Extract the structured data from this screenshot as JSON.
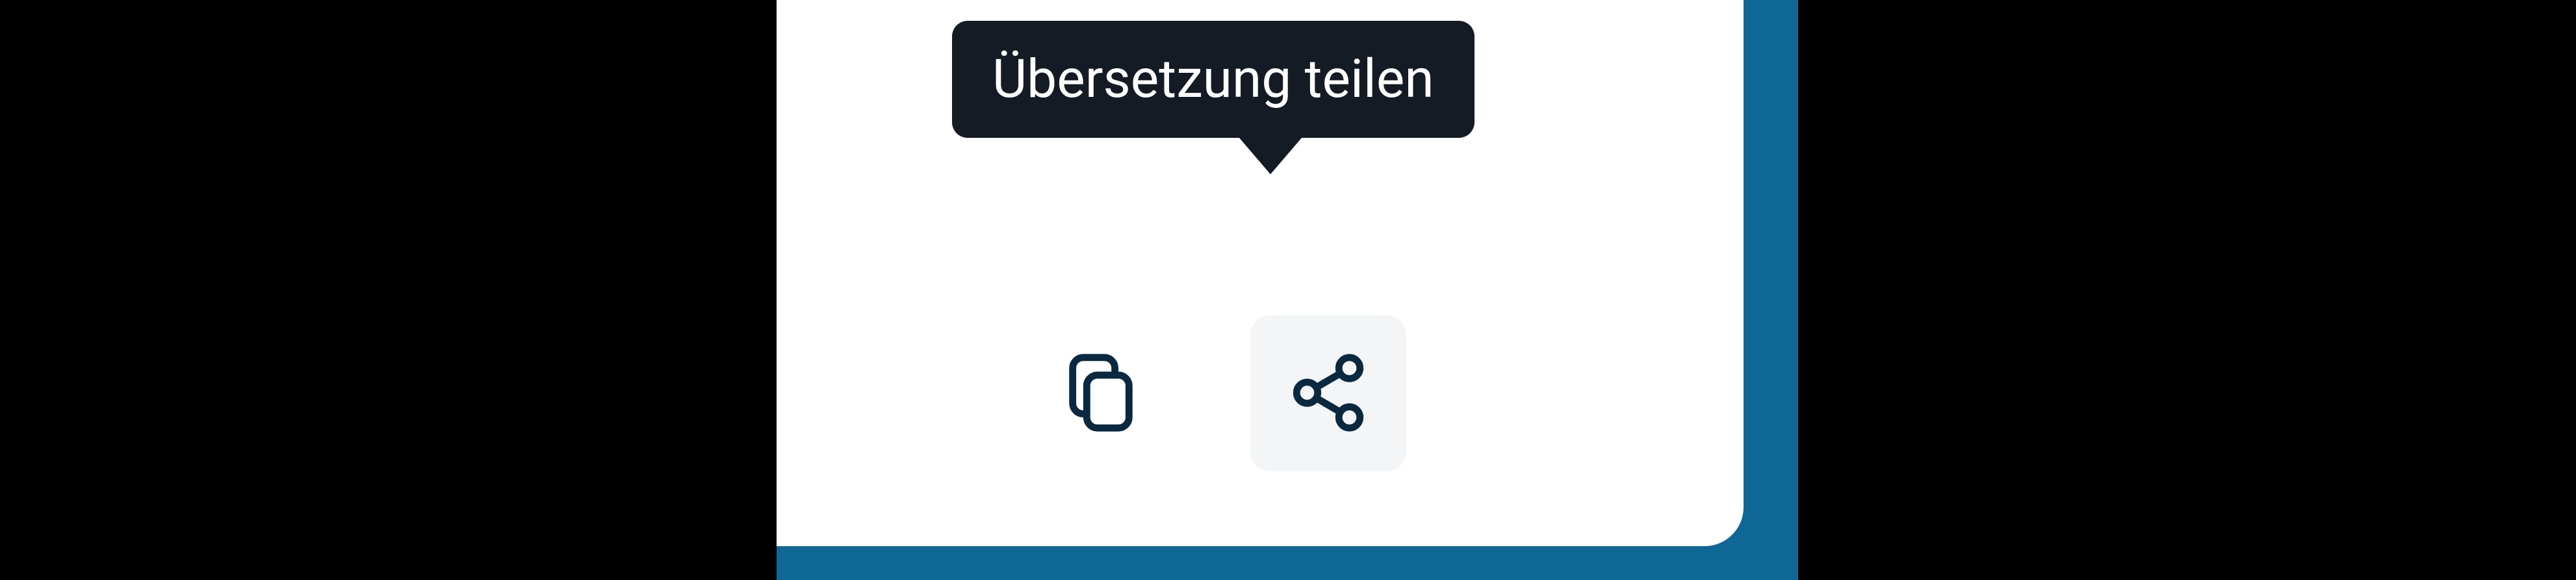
{
  "tooltip": {
    "share_label": "Übersetzung teilen"
  },
  "toolbar": {
    "copy_button": "copy",
    "share_button": "share"
  },
  "colors": {
    "accent": "#0f6796",
    "tooltip_bg": "#151b24",
    "icon_stroke": "#0a2940",
    "hover_bg": "#f3f5f7"
  }
}
